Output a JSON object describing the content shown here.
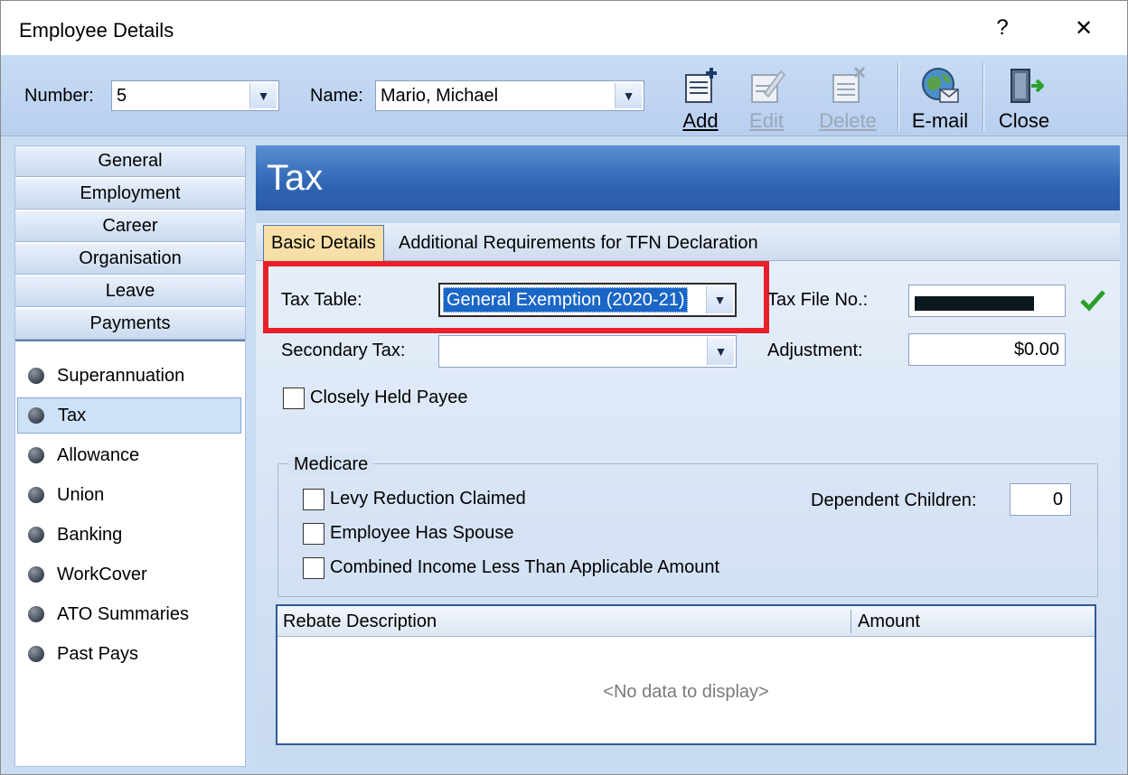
{
  "window": {
    "title": "Employee Details",
    "help_label": "?",
    "close_label": "✕"
  },
  "toolbar": {
    "number_label": "Number:",
    "number_value": "5",
    "name_label": "Name:",
    "name_value": "Mario, Michael",
    "buttons": [
      {
        "label": "Add",
        "icon": "add-document-icon",
        "enabled": true
      },
      {
        "label": "Edit",
        "icon": "edit-document-icon",
        "enabled": false
      },
      {
        "label": "Delete",
        "icon": "delete-document-icon",
        "enabled": false
      },
      {
        "label": "E-mail",
        "icon": "globe-email-icon",
        "enabled": true
      },
      {
        "label": "Close",
        "icon": "exit-door-icon",
        "enabled": true
      }
    ]
  },
  "nav": {
    "groups": [
      "General",
      "Employment",
      "Career",
      "Organisation",
      "Leave",
      "Payments"
    ],
    "items": [
      "Superannuation",
      "Tax",
      "Allowance",
      "Union",
      "Banking",
      "WorkCover",
      "ATO Summaries",
      "Past Pays"
    ],
    "selected": "Tax"
  },
  "main": {
    "header_title": "Tax",
    "tabs": [
      {
        "label": "Basic Details",
        "active": true
      },
      {
        "label": "Additional Requirements for TFN Declaration",
        "active": false
      }
    ],
    "tax_table_label": "Tax Table:",
    "tax_table_value": "General Exemption (2020-21)",
    "secondary_tax_label": "Secondary Tax:",
    "secondary_tax_value": "",
    "tax_file_label": "Tax File No.:",
    "adjustment_label": "Adjustment:",
    "adjustment_value": "$0.00",
    "closely_held_label": "Closely Held Payee",
    "medicare": {
      "title": "Medicare",
      "levy_label": "Levy Reduction Claimed",
      "spouse_label": "Employee Has Spouse",
      "combined_label": "Combined Income Less Than Applicable Amount",
      "dependent_label": "Dependent Children:",
      "dependent_value": "0"
    },
    "grid": {
      "columns": [
        "Rebate Description",
        "Amount"
      ],
      "empty_text": "<No data to display>"
    }
  },
  "colors": {
    "highlight": "#e8202a",
    "header_blue": "#2f65b4",
    "tick_green": "#2aa02a"
  }
}
